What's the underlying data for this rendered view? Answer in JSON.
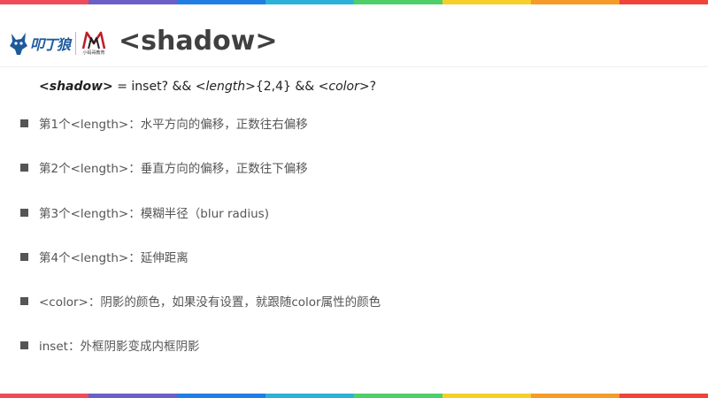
{
  "colors": {
    "rainbow": [
      "#f04b5a",
      "#6c5fc7",
      "#1f7ee3",
      "#2cb1d8",
      "#4fcf6a",
      "#f7cf2a",
      "#f79a26",
      "#f0443a"
    ],
    "title_text": "#404040",
    "bullet": "#555555"
  },
  "header": {
    "logo_text": "叩丁狼",
    "logo2_name": "小码哥教育",
    "title": "<shadow>"
  },
  "syntax": {
    "name": "<shadow>",
    "part1": " = inset? && ",
    "length": "<length>",
    "repeat": "{2,4}",
    "part2": " && ",
    "color": "<color>",
    "end": "?"
  },
  "bullets": [
    "第1个<length>：水平方向的偏移，正数往右偏移",
    "第2个<length>：垂直方向的偏移，正数往下偏移",
    "第3个<length>：模糊半径（blur radius)",
    "第4个<length>：延伸距离",
    "<color>：阴影的颜色，如果没有设置，就跟随color属性的颜色",
    "inset：外框阴影变成内框阴影"
  ]
}
